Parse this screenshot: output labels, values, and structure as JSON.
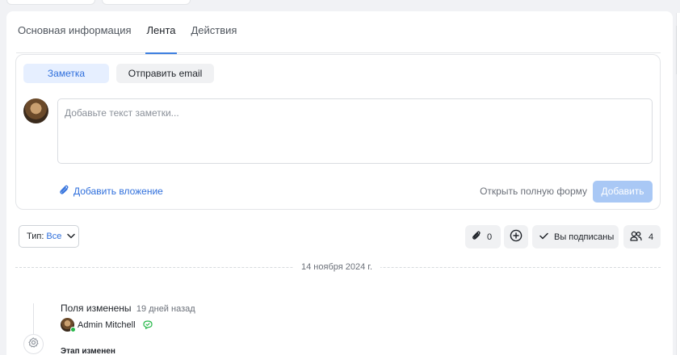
{
  "tabs": [
    {
      "label": "Основная информация"
    },
    {
      "label": "Лента"
    },
    {
      "label": "Действия"
    }
  ],
  "composer": {
    "modes": {
      "note": "Заметка",
      "email": "Отправить email"
    },
    "placeholder": "Добавьте текст заметки...",
    "attach_label": "Добавить вложение",
    "full_form_label": "Открыть полную форму",
    "submit_label": "Добавить"
  },
  "filters": {
    "type_label": "Тип:",
    "type_value": "Все",
    "attachments_count": "0",
    "subscribed_label": "Вы подписаны",
    "followers_count": "4"
  },
  "feed": {
    "date": "14 ноября 2024 г.",
    "events": [
      {
        "title": "Поля изменены",
        "time": "19 дней назад",
        "user": "Admin Mitchell"
      },
      {
        "title": "Этап изменен"
      }
    ]
  },
  "colors": {
    "accent": "#2f6fdc",
    "tab_underline": "#3d7fe0",
    "submit_disabled": "#a9c8f5",
    "online": "#27b84a"
  }
}
